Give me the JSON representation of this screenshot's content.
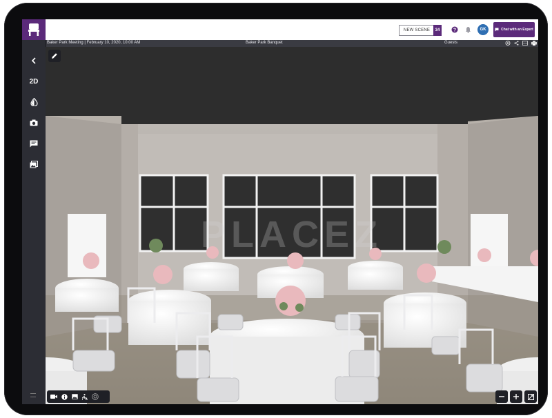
{
  "topbar": {
    "new_scene_label": "NEW SCENE",
    "scene_count": "34",
    "avatar_initials": "GK",
    "chat_label": "Chat with an Expert"
  },
  "infobar": {
    "event": "Baker Park Meeting | February 10, 2020, 10:00 AM",
    "room": "Baker Park Banquet",
    "guests_label": "Guests"
  },
  "sidebar": {
    "items": [
      {
        "icon": "back-arrow-icon"
      },
      {
        "label": "2D"
      },
      {
        "icon": "contrast-icon"
      },
      {
        "icon": "camera-icon"
      },
      {
        "icon": "chat-icon"
      },
      {
        "icon": "gallery-icon"
      }
    ]
  },
  "colors": {
    "brand": "#5b2a7a",
    "sidebar": "#2c2d34",
    "avatar": "#2f6fb3"
  }
}
